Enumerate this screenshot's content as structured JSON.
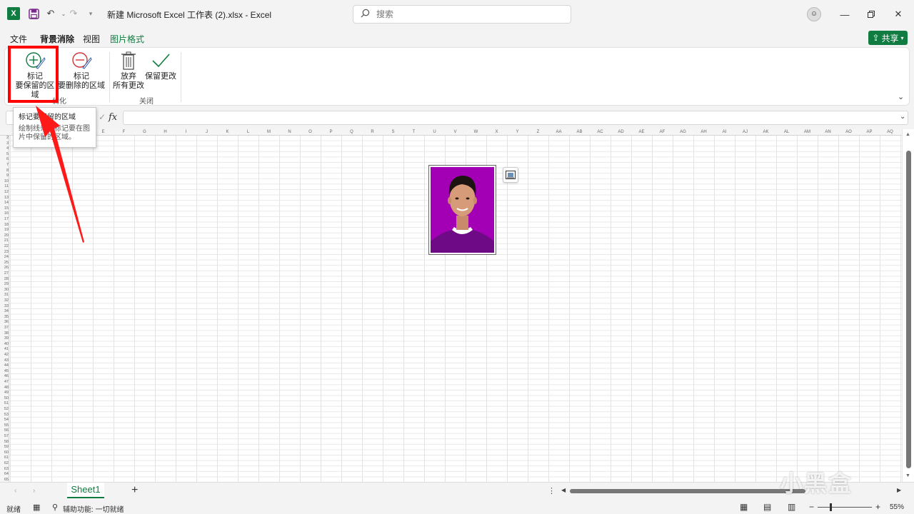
{
  "titlebar": {
    "excel_logo": "X",
    "doc_title": "新建 Microsoft Excel 工作表 (2).xlsx  -  Excel",
    "search_placeholder": "搜索",
    "avatar": "☺"
  },
  "tabs": [
    {
      "label": "文件"
    },
    {
      "label": "背景消除"
    },
    {
      "label": "视图"
    },
    {
      "label": "图片格式"
    }
  ],
  "share_label": "共享",
  "ribbon": {
    "mark_keep_line1": "标记",
    "mark_keep_line2": "要保留的区域",
    "mark_remove_line1": "标记",
    "mark_remove_line2": "要删除的区域",
    "discard_line1": "放弃",
    "discard_line2": "所有更改",
    "keep_changes": "保留更改",
    "group_refine": "优化",
    "group_close": "关闭"
  },
  "tooltip": {
    "title": "标记要保留的区域",
    "body": "绘制线条以标记要在图片中保留的区域。"
  },
  "formula": {
    "fx": "fx"
  },
  "columns": [
    "A",
    "B",
    "C",
    "D",
    "E",
    "F",
    "G",
    "H",
    "I",
    "J",
    "K",
    "L",
    "M",
    "N",
    "O",
    "P",
    "Q",
    "R",
    "S",
    "T",
    "U",
    "V",
    "W",
    "X",
    "Y",
    "Z",
    "AA",
    "AB",
    "AC",
    "AD",
    "AE",
    "AF",
    "AG",
    "AH",
    "AI",
    "AJ",
    "AK",
    "AL",
    "AM",
    "AN",
    "AO",
    "AP",
    "AQ"
  ],
  "sheet": {
    "tab_label": "Sheet1"
  },
  "status": {
    "ready": "就绪",
    "accessibility": "辅助功能: 一切就绪",
    "zoom": "55%"
  },
  "watermark": "小黑盒",
  "colors": {
    "accent": "#107c41",
    "highlight": "#ff0000",
    "photo_background": "#a300b5"
  }
}
